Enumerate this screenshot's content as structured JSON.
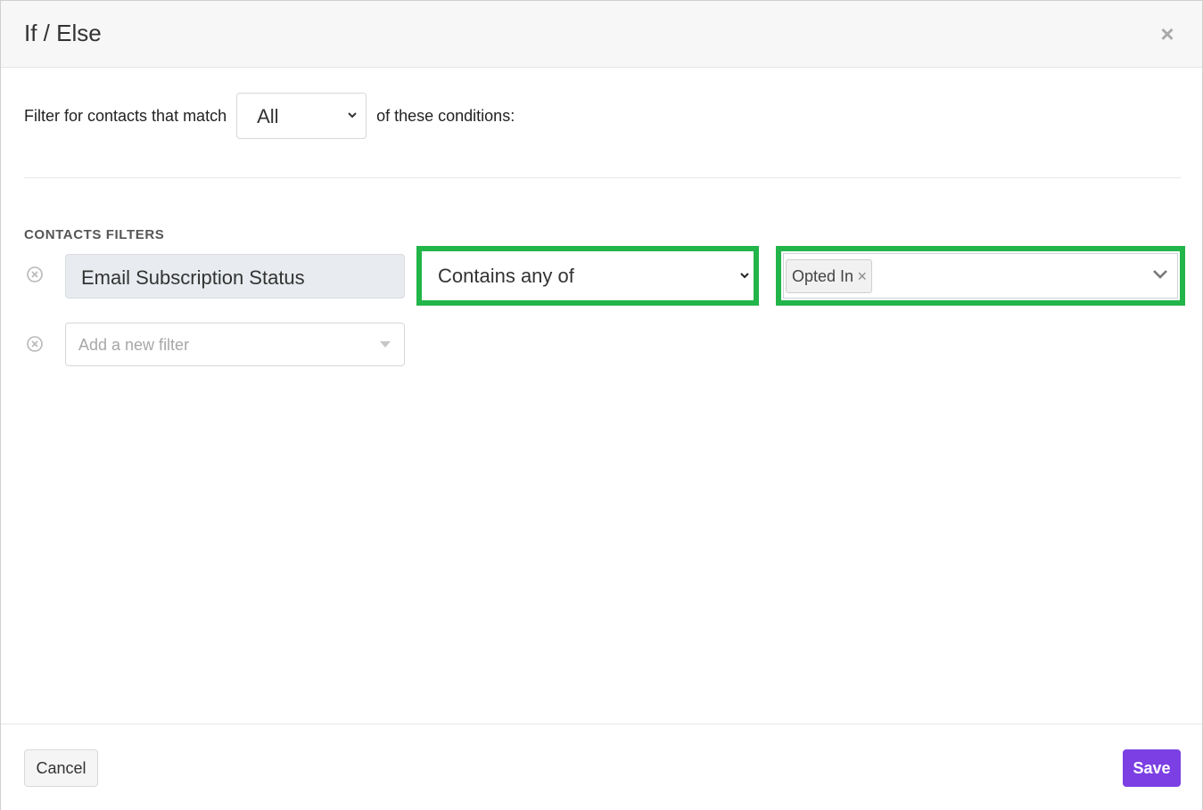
{
  "dialog": {
    "title": "If / Else",
    "close_label": "×"
  },
  "match": {
    "prefix": "Filter for contacts that match",
    "selected": "All",
    "suffix": "of these conditions:"
  },
  "filters": {
    "section_label": "CONTACTS FILTERS",
    "rows": [
      {
        "field": "Email Subscription Status",
        "operator": "Contains any of",
        "values": [
          "Opted In"
        ]
      }
    ],
    "new_filter_placeholder": "Add a new filter"
  },
  "footer": {
    "cancel_label": "Cancel",
    "save_label": "Save"
  },
  "colors": {
    "highlight": "#22b549",
    "primary": "#7b3fe4"
  }
}
